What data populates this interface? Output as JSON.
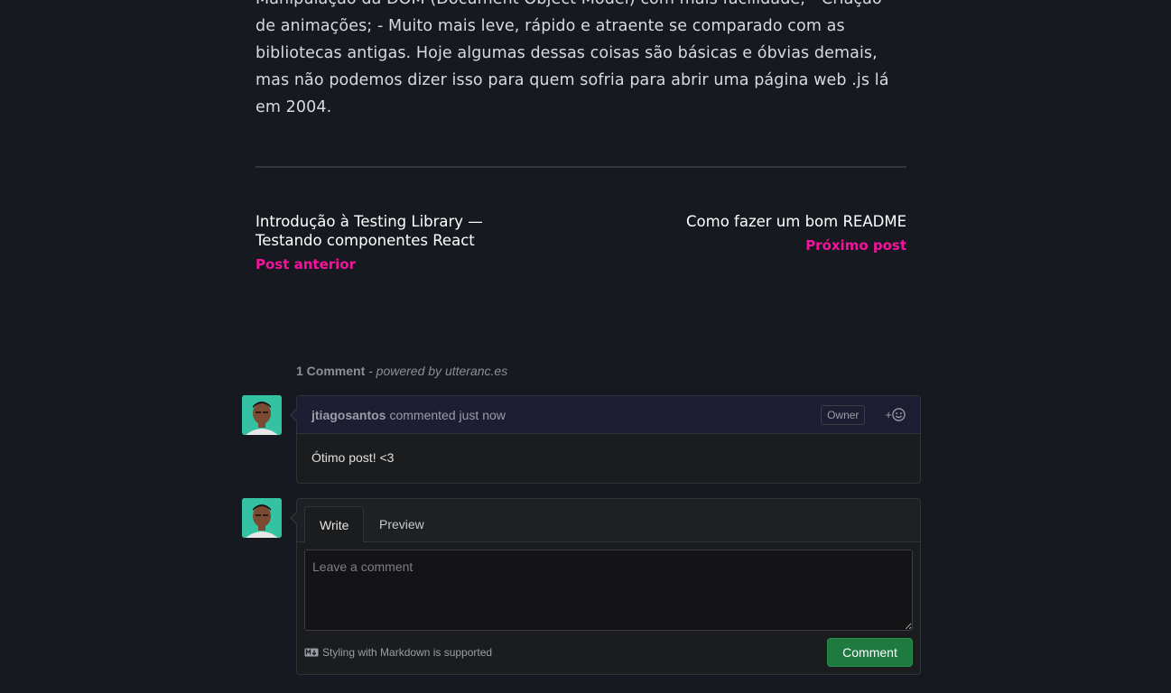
{
  "article": {
    "text": "Manipulação da DOM (Document Object Model) com mais facilidade; - Criação de animações; - Muito mais leve, rápido e atraente se comparado com as bibliotecas antigas. Hoje algumas dessas coisas são básicas e óbvias demais, mas não podemos dizer isso para quem sofria para abrir uma página web .js lá em 2004."
  },
  "post_nav": {
    "previous": {
      "title": "Introdução à Testing Library — Testando componentes React",
      "label": "Post anterior"
    },
    "next": {
      "title": "Como fazer um bom README",
      "label": "Próximo post"
    }
  },
  "comments": {
    "count_label": "1 Comment",
    "powered_by": " - powered by utteranc.es",
    "items": [
      {
        "author": "jtiagosantos",
        "action": "commented",
        "time": "just now",
        "badge": "Owner",
        "reaction_label": "+",
        "body": "Ótimo post! <3"
      }
    ]
  },
  "editor": {
    "tabs": {
      "write": "Write",
      "preview": "Preview"
    },
    "placeholder": "Leave a comment",
    "markdown_note": "Styling with Markdown is supported",
    "submit_label": "Comment"
  },
  "colors": {
    "background": "#16191f",
    "accent": "#f2149b",
    "button": "#1f7a3f"
  }
}
